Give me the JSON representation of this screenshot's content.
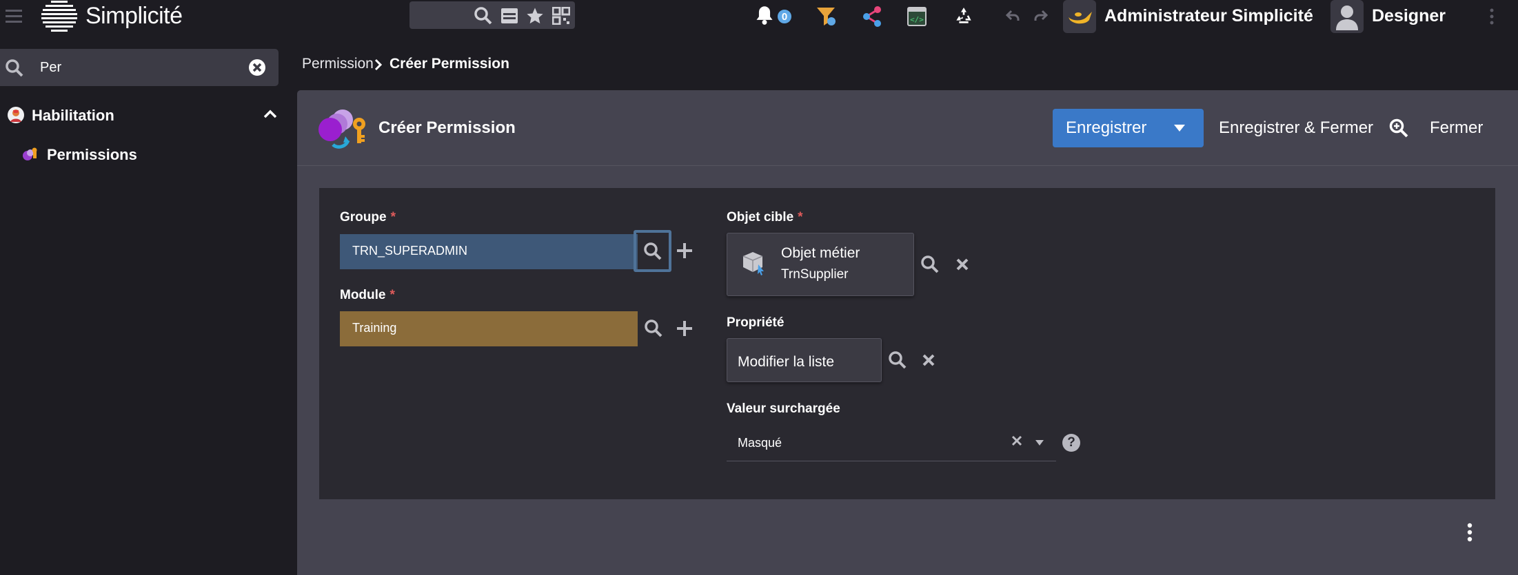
{
  "header": {
    "brand_name": "Simplicité",
    "notification_count": "0",
    "user_name": "Administrateur Simplicité",
    "role_name": "Designer"
  },
  "sidebar": {
    "search_value": "Per",
    "section_label": "Habilitation",
    "items": [
      {
        "label": "Permissions"
      }
    ]
  },
  "breadcrumb": {
    "parent": "Permission",
    "current": "Créer Permission"
  },
  "form": {
    "title": "Créer Permission",
    "actions": {
      "save_label": "Enregistrer",
      "save_close_label": "Enregistrer & Fermer",
      "close_label": "Fermer"
    },
    "fields": {
      "groupe": {
        "label": "Groupe",
        "required_mark": "*",
        "value": "TRN_SUPERADMIN"
      },
      "module": {
        "label": "Module",
        "required_mark": "*",
        "value": "Training"
      },
      "objet_cible": {
        "label": "Objet cible",
        "required_mark": "*",
        "value_line1": "Objet métier",
        "value_line2": "TrnSupplier"
      },
      "propriete": {
        "label": "Propriété",
        "value": "Modifier la liste"
      },
      "valeur_surchargee": {
        "label": "Valeur surchargée",
        "value": "Masqué",
        "help": "?"
      }
    }
  },
  "colors": {
    "accent": "#3a79c8",
    "groupe_bg": "#3e5878",
    "module_bg": "#8b6c3a",
    "required": "#e05b5b"
  }
}
